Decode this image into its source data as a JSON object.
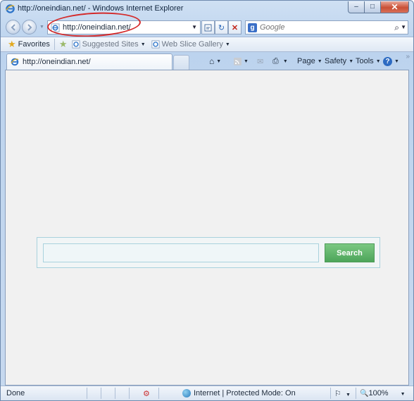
{
  "window": {
    "title": "http://oneindian.net/ - Windows Internet Explorer",
    "controls": {
      "minimize": "–",
      "maximize": "□",
      "close": "✕"
    }
  },
  "nav": {
    "address": "http://oneindian.net/",
    "search_placeholder": "Google",
    "search_provider_letter": "g"
  },
  "favorites_bar": {
    "favorites_label": "Favorites",
    "suggested_sites_label": "Suggested Sites",
    "web_slice_gallery_label": "Web Slice Gallery"
  },
  "tab": {
    "label": "http://oneindian.net/"
  },
  "command_bar": {
    "page_label": "Page",
    "safety_label": "Safety",
    "tools_label": "Tools"
  },
  "page": {
    "search_button_label": "Search"
  },
  "status_bar": {
    "status_text": "Done",
    "zone_text": "Internet | Protected Mode: On",
    "zoom_text": "100%"
  },
  "colors": {
    "accent": "#4da55a",
    "highlight": "#d42a2a"
  }
}
